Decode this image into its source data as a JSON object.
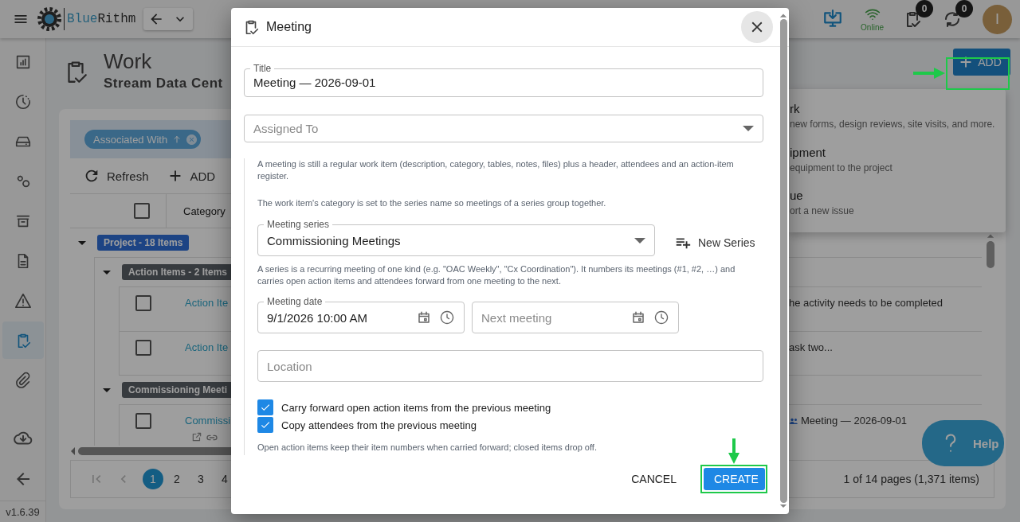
{
  "header": {
    "brand": [
      "Blue",
      "Rithm"
    ],
    "connection": "Online",
    "counters": [
      {
        "count": "0"
      },
      {
        "count": "0"
      }
    ],
    "avatar": "I"
  },
  "sidebar": {
    "items": [
      {
        "selected": false
      },
      {
        "selected": false
      },
      {
        "selected": false
      },
      {
        "selected": false
      },
      {
        "selected": false
      },
      {
        "selected": false
      },
      {
        "selected": false
      },
      {
        "selected": true
      },
      {
        "selected": false
      }
    ],
    "version": "v1.6.39"
  },
  "page": {
    "title": "Work",
    "subtitle": "Stream Data Cent"
  },
  "filters": [
    {
      "label": "Associated With"
    }
  ],
  "toolbar": [
    {
      "label": "Refresh"
    },
    {
      "label": "ADD"
    }
  ],
  "table": {
    "columns": [
      "Category"
    ],
    "groups": [
      {
        "label": "Project - 18 Items",
        "kind": "project",
        "expanded": true,
        "children": [
          {
            "label": "Action Items - 2 Items",
            "kind": "category",
            "expanded": true,
            "rows": [
              {
                "link": "Action Ite",
                "text": "he activity needs to be completed",
                "kind": "action_item",
                "selected": false
              },
              {
                "link": "Action Ite",
                "text": "ask two...",
                "kind": "action_item",
                "selected": false
              }
            ]
          },
          {
            "label": "Commissioning Meeti",
            "kind": "category",
            "expanded": true,
            "rows": [
              {
                "link": "Commissi",
                "text": "Meeting — 2026-09-01",
                "kind": "meeting",
                "selected": false
              }
            ]
          }
        ]
      }
    ],
    "select_all": false
  },
  "pagination": {
    "pages": [
      {
        "label": "1",
        "selected": true
      },
      {
        "label": "2",
        "selected": false
      },
      {
        "label": "3",
        "selected": false
      },
      {
        "label": "4",
        "selected": false
      }
    ],
    "summary": "1 of 14 pages (1,371 items)"
  },
  "add_button": {
    "label": "ADD"
  },
  "add_menu": [
    {
      "title": "rk",
      "description": "new forms, design reviews, site visits, and more."
    },
    {
      "title": "ipment",
      "description": "equipment to the project"
    },
    {
      "title": "ue",
      "description": "ort a new issue"
    }
  ],
  "help_button": {
    "label": "Help"
  },
  "dialog": {
    "title": "Meeting",
    "title_field": {
      "label": "Title",
      "value": "Meeting — 2026-09-01"
    },
    "assigned_to": {
      "placeholder": "Assigned To"
    },
    "intro": [
      "A meeting is still a regular work item (description, category, tables, notes, files) plus a header, attendees and an action-item register.",
      "The work item's category is set to the series name so meetings of a series group together."
    ],
    "series": {
      "label": "Meeting series",
      "value": "Commissioning Meetings"
    },
    "new_series_button": "New Series",
    "series_help": "A series is a recurring meeting of one kind (e.g. \"OAC Weekly\", \"Cx Coordination\"). It numbers its meetings (#1, #2, …) and carries open action items and attendees forward from one meeting to the next.",
    "meeting_date": {
      "label": "Meeting date",
      "value": "9/1/2026 10:00 AM"
    },
    "next_meeting": {
      "placeholder": "Next meeting"
    },
    "location": {
      "placeholder": "Location"
    },
    "options": [
      {
        "label": "Carry forward open action items from the previous meeting",
        "checked": true
      },
      {
        "label": "Copy attendees from the previous meeting",
        "checked": true
      }
    ],
    "note": "Open action items keep their item numbers when carried forward; closed items drop off.",
    "buttons": [
      {
        "label": "CANCEL",
        "kind": "text"
      },
      {
        "label": "CREATE",
        "kind": "primary"
      }
    ]
  }
}
